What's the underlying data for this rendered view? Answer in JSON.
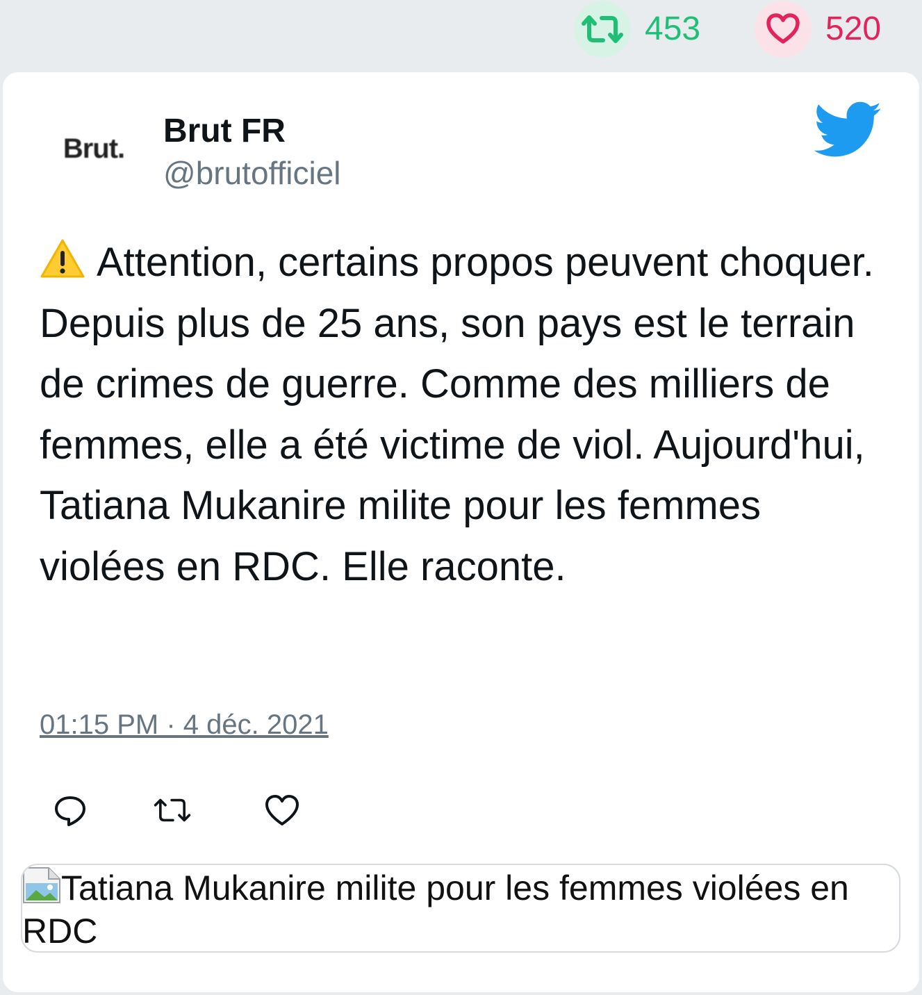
{
  "stats": {
    "retweets": "453",
    "likes": "520",
    "retweet_color": "#1fbf78",
    "like_color": "#e3245c"
  },
  "author": {
    "avatar_text": "Brut.",
    "name": "Brut FR",
    "handle": "@brutofficiel"
  },
  "tweet": {
    "emoji_icon": "warning-icon",
    "text": "Attention, certains propos peuvent choquer. Depuis plus de 25 ans, son pays est le terrain de crimes de guerre. Comme des milliers de femmes, elle a été victime de viol. Aujourd'hui, Tatiana Mukanire milite pour les femmes violées en RDC. Elle raconte.",
    "timestamp": "01:15 PM · 4 déc. 2021"
  },
  "actions": {
    "icons": [
      "reply-icon",
      "retweet-icon",
      "like-icon"
    ]
  },
  "media": {
    "alt_text": "Tatiana Mukanire milite pour les femmes violées en RDC"
  },
  "colors": {
    "twitter_blue": "#1d9bf0",
    "text_gray": "#66757f"
  }
}
